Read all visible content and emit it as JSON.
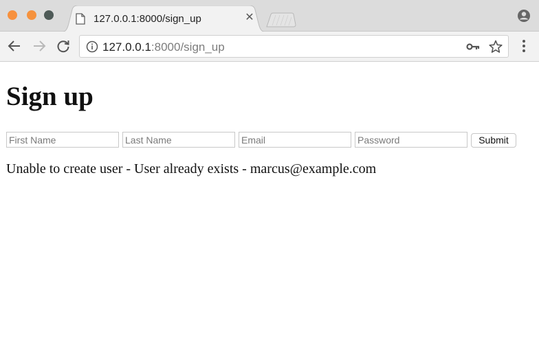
{
  "browser": {
    "tab": {
      "title": "127.0.0.1:8000/sign_up",
      "close_glyph": "✕",
      "icon": "page-icon"
    },
    "address": {
      "host": "127.0.0.1",
      "path": ":8000/sign_up"
    },
    "icons": {
      "back": "back-arrow-icon",
      "forward": "forward-arrow-icon",
      "reload": "reload-icon",
      "info": "info-icon",
      "key": "key-icon",
      "star": "star-icon",
      "menu": "menu-icon",
      "profile": "profile-icon"
    },
    "colors": {
      "close_button": "#f7913e",
      "minimize_button": "#f5923e",
      "maximize_button": "#4e5a57"
    }
  },
  "page": {
    "title": "Sign up",
    "form": {
      "first_name_placeholder": "First Name",
      "last_name_placeholder": "Last Name",
      "email_placeholder": "Email",
      "password_placeholder": "Password",
      "submit_label": "Submit"
    },
    "error_message": "Unable to create user - User already exists - marcus@example.com"
  }
}
